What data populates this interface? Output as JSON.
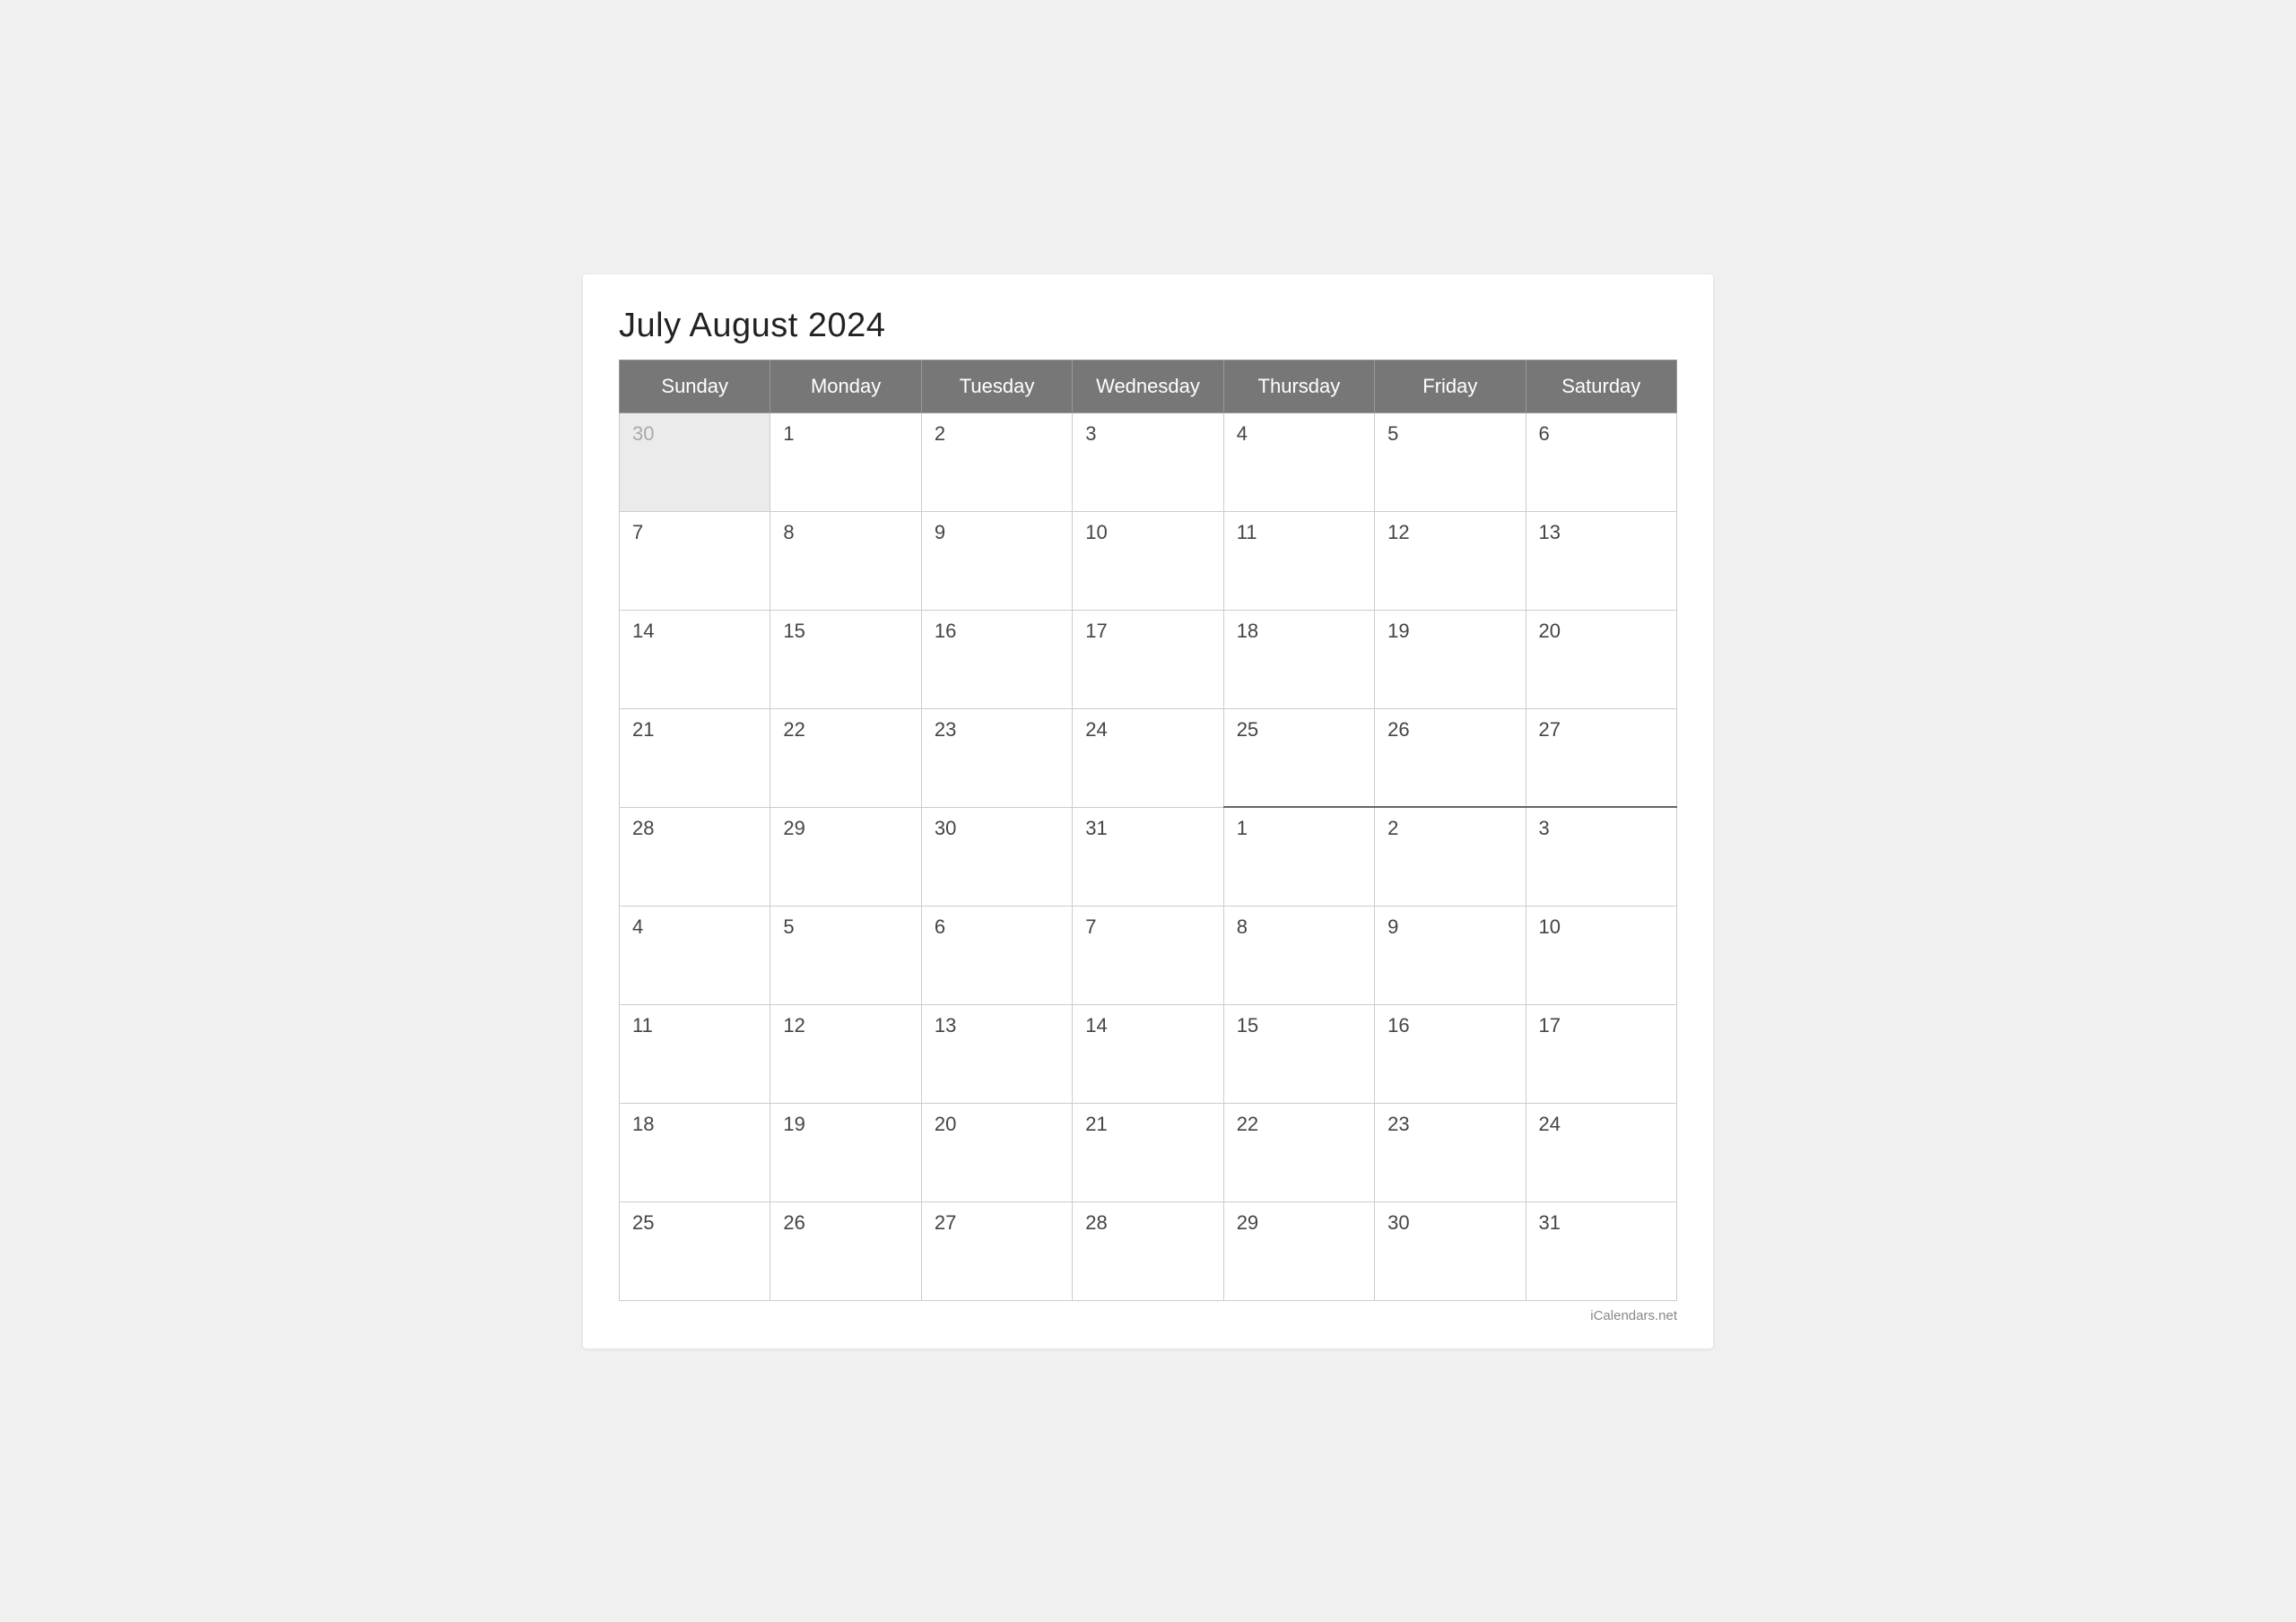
{
  "title": "July August 2024",
  "footer": "iCalendars.net",
  "headers": [
    "Sunday",
    "Monday",
    "Tuesday",
    "Wednesday",
    "Thursday",
    "Friday",
    "Saturday"
  ],
  "weeks": [
    [
      {
        "day": "30",
        "type": "prev-month"
      },
      {
        "day": "1",
        "type": "current"
      },
      {
        "day": "2",
        "type": "current"
      },
      {
        "day": "3",
        "type": "current"
      },
      {
        "day": "4",
        "type": "current"
      },
      {
        "day": "5",
        "type": "current"
      },
      {
        "day": "6",
        "type": "current"
      }
    ],
    [
      {
        "day": "7",
        "type": "current"
      },
      {
        "day": "8",
        "type": "current"
      },
      {
        "day": "9",
        "type": "current"
      },
      {
        "day": "10",
        "type": "current"
      },
      {
        "day": "11",
        "type": "current"
      },
      {
        "day": "12",
        "type": "current"
      },
      {
        "day": "13",
        "type": "current"
      }
    ],
    [
      {
        "day": "14",
        "type": "current"
      },
      {
        "day": "15",
        "type": "current"
      },
      {
        "day": "16",
        "type": "current"
      },
      {
        "day": "17",
        "type": "current"
      },
      {
        "day": "18",
        "type": "current"
      },
      {
        "day": "19",
        "type": "current"
      },
      {
        "day": "20",
        "type": "current"
      }
    ],
    [
      {
        "day": "21",
        "type": "current"
      },
      {
        "day": "22",
        "type": "current"
      },
      {
        "day": "23",
        "type": "current"
      },
      {
        "day": "24",
        "type": "current"
      },
      {
        "day": "25",
        "type": "current"
      },
      {
        "day": "26",
        "type": "current"
      },
      {
        "day": "27",
        "type": "current"
      }
    ],
    [
      {
        "day": "28",
        "type": "current"
      },
      {
        "day": "29",
        "type": "current"
      },
      {
        "day": "30",
        "type": "current"
      },
      {
        "day": "31",
        "type": "current"
      },
      {
        "day": "1",
        "type": "new-month"
      },
      {
        "day": "2",
        "type": "new-month"
      },
      {
        "day": "3",
        "type": "new-month"
      }
    ],
    [
      {
        "day": "4",
        "type": "next-month-current"
      },
      {
        "day": "5",
        "type": "next-month-current"
      },
      {
        "day": "6",
        "type": "next-month-current"
      },
      {
        "day": "7",
        "type": "next-month-current"
      },
      {
        "day": "8",
        "type": "next-month-current"
      },
      {
        "day": "9",
        "type": "next-month-current"
      },
      {
        "day": "10",
        "type": "next-month-current"
      }
    ],
    [
      {
        "day": "11",
        "type": "next-month-current"
      },
      {
        "day": "12",
        "type": "next-month-current"
      },
      {
        "day": "13",
        "type": "next-month-current"
      },
      {
        "day": "14",
        "type": "next-month-current"
      },
      {
        "day": "15",
        "type": "next-month-current"
      },
      {
        "day": "16",
        "type": "next-month-current"
      },
      {
        "day": "17",
        "type": "next-month-current"
      }
    ],
    [
      {
        "day": "18",
        "type": "next-month-current"
      },
      {
        "day": "19",
        "type": "next-month-current"
      },
      {
        "day": "20",
        "type": "next-month-current"
      },
      {
        "day": "21",
        "type": "next-month-current"
      },
      {
        "day": "22",
        "type": "next-month-current"
      },
      {
        "day": "23",
        "type": "next-month-current"
      },
      {
        "day": "24",
        "type": "next-month-current"
      }
    ],
    [
      {
        "day": "25",
        "type": "next-month-current"
      },
      {
        "day": "26",
        "type": "next-month-current"
      },
      {
        "day": "27",
        "type": "next-month-current"
      },
      {
        "day": "28",
        "type": "next-month-current"
      },
      {
        "day": "29",
        "type": "next-month-current"
      },
      {
        "day": "30",
        "type": "next-month-current"
      },
      {
        "day": "31",
        "type": "next-month-current"
      }
    ]
  ]
}
